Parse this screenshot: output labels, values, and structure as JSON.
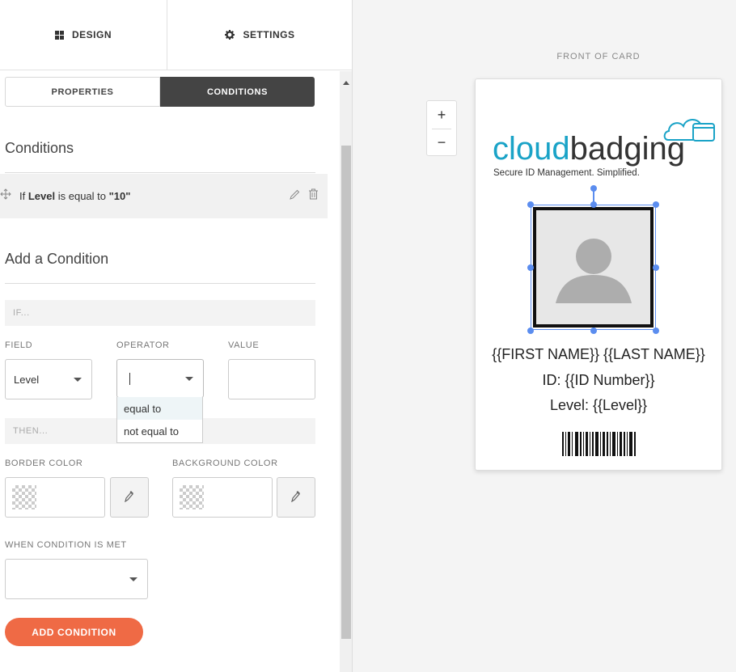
{
  "tabs": {
    "design": "DESIGN",
    "settings": "SETTINGS"
  },
  "subtabs": {
    "properties": "PROPERTIES",
    "conditions": "CONDITIONS"
  },
  "conditions": {
    "heading": "Conditions",
    "rule": {
      "prefix": "If",
      "field": "Level",
      "middle": "is equal to",
      "value": "\"10\""
    }
  },
  "add_condition": {
    "heading": "Add a Condition",
    "if_label": "IF...",
    "field_label": "FIELD",
    "operator_label": "OPERATOR",
    "value_label": "VALUE",
    "field_value": "Level",
    "operator_value": "",
    "value_value": "",
    "operator_options": [
      "equal to",
      "not equal to"
    ],
    "then_label": "THEN...",
    "border_color_label": "BORDER COLOR",
    "background_color_label": "BACKGROUND COLOR",
    "when_met_label": "WHEN CONDITION IS MET",
    "when_met_value": "",
    "submit_label": "ADD CONDITION"
  },
  "canvas": {
    "front_label": "FRONT OF CARD",
    "zoom_in": "+",
    "zoom_out": "−",
    "card": {
      "logo_main": "cloudbadging",
      "logo_tagline": "Secure ID Management. Simplified.",
      "name_line": "{{FIRST NAME}} {{LAST NAME}}",
      "id_line": "ID: {{ID Number}}",
      "level_line": "Level: {{Level}}"
    }
  },
  "colors": {
    "accent": "#ef6a45",
    "active_tab": "#444444",
    "selection": "#5b8def",
    "logo_blue": "#1aa3c7"
  }
}
